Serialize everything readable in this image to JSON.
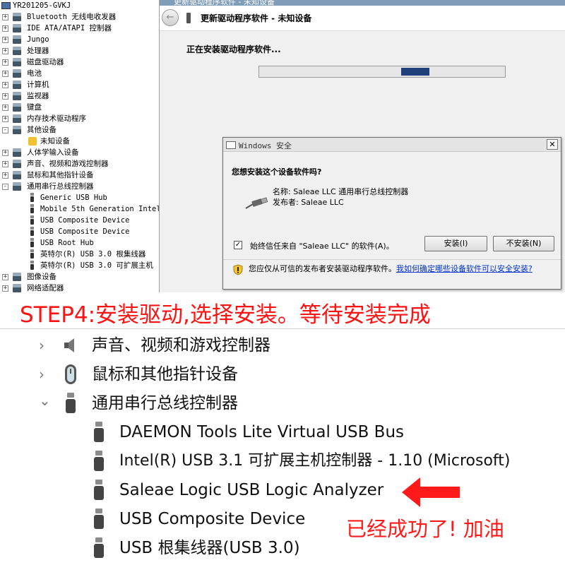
{
  "tree": {
    "root": "YR201205-GVKJ",
    "items": [
      {
        "label": "Bluetooth 无线电收发器",
        "expander": "+"
      },
      {
        "label": "IDE ATA/ATAPI 控制器",
        "expander": "+"
      },
      {
        "label": "Jungo",
        "expander": "+"
      },
      {
        "label": "处理器",
        "expander": "+"
      },
      {
        "label": "磁盘驱动器",
        "expander": "+"
      },
      {
        "label": "电池",
        "expander": "+"
      },
      {
        "label": "计算机",
        "expander": "+"
      },
      {
        "label": "监视器",
        "expander": "+"
      },
      {
        "label": "键盘",
        "expander": "+"
      },
      {
        "label": "内存技术驱动程序",
        "expander": "+"
      },
      {
        "label": "其他设备",
        "expander": "-"
      },
      {
        "label": "未知设备",
        "expander": ""
      },
      {
        "label": "人体学输入设备",
        "expander": "+"
      },
      {
        "label": "声音、视频和游戏控制器",
        "expander": "+"
      },
      {
        "label": "鼠标和其他指针设备",
        "expander": "+"
      },
      {
        "label": "通用串行总线控制器",
        "expander": "-"
      },
      {
        "label": "Generic USB Hub",
        "expander": ""
      },
      {
        "label": "Mobile 5th Generation Intel",
        "expander": ""
      },
      {
        "label": "USB Composite Device",
        "expander": ""
      },
      {
        "label": "USB Composite Device",
        "expander": ""
      },
      {
        "label": "USB Root Hub",
        "expander": ""
      },
      {
        "label": "英特尔(R) USB 3.0 根集线器",
        "expander": ""
      },
      {
        "label": "英特尔(R) USB 3.0 可扩展主机",
        "expander": ""
      },
      {
        "label": "图像设备",
        "expander": "+"
      },
      {
        "label": "网络适配器",
        "expander": "+"
      }
    ]
  },
  "wizard": {
    "window_title": "更新驱动程序软件 - 未知设备",
    "header_title": "更新驱动程序软件 - 未知设备",
    "status_text": "正在安装驱动程序软件...",
    "progress_indeterminate": true
  },
  "security_dialog": {
    "title": "Windows 安全",
    "close_glyph": "✕",
    "question": "您想安装这个设备软件吗?",
    "name_line": "名称: Saleae LLC 通用串行总线控制器",
    "publisher_line": "发布者: Saleae LLC",
    "trust_checked": true,
    "trust_label": "始终信任来自 \"Saleae LLC\" 的软件(A)。",
    "install_button": "安装(I)",
    "dont_install_button": "不安装(N)",
    "footer_text": "您应仅从可信的发布者安装驱动程序软件。",
    "footer_link": "我如何确定哪些设备软件可以安全安装?"
  },
  "step_caption": "STEP4:安装驱动,选择安装。等待安装完成",
  "zoom": {
    "rows": [
      {
        "label": "声音、视频和游戏控制器",
        "chevron": "›"
      },
      {
        "label": "鼠标和其他指针设备",
        "chevron": "›"
      },
      {
        "label": "通用串行总线控制器",
        "chevron": "⌄"
      },
      {
        "label": "DAEMON Tools Lite Virtual USB Bus"
      },
      {
        "label": "Intel(R) USB 3.1 可扩展主机控制器 - 1.10 (Microsoft)"
      },
      {
        "label": "Saleae Logic USB Logic Analyzer"
      },
      {
        "label": "USB Composite Device"
      },
      {
        "label": "USB 根集线器(USB 3.0)"
      }
    ]
  },
  "success_note": "已经成功了! 加油",
  "colors": {
    "caption_red": "#ff1212",
    "progress_fill": "#1f3f7a",
    "link_blue": "#0033cc"
  }
}
